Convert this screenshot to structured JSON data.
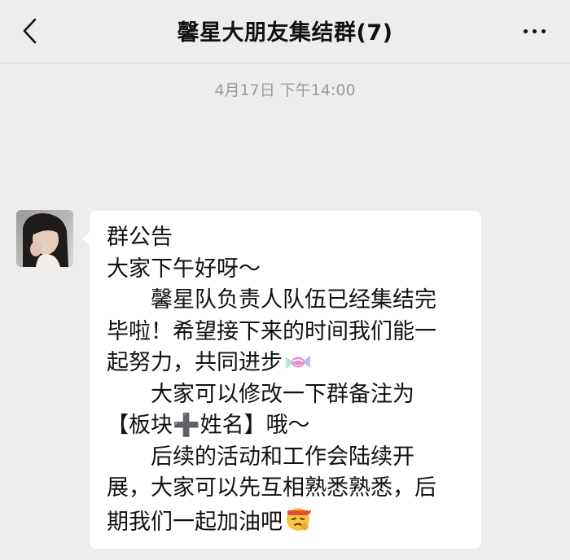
{
  "header": {
    "title": "馨星大朋友集结群(7)"
  },
  "timestamp": "4月17日 下午14:00",
  "message": {
    "lines": [
      "群公告",
      "大家下午好呀～",
      "馨星队负责人队伍已经集结完",
      "毕啦！希望接下来的时间我们能一",
      "起努力，共同进步",
      "大家可以修改一下群备注为",
      "【板块➕姓名】哦～",
      "后续的活动和工作会陆续开",
      "展，大家可以先互相熟悉熟悉，后",
      "期我们一起加油吧"
    ]
  },
  "icons": {
    "back": "chevron-left-icon",
    "more": "more-dots-icon",
    "candy": "candy-emoji-icon",
    "fighting": "fighting-face-emoji-icon"
  },
  "colors": {
    "background": "#ededed",
    "bubble": "#ffffff",
    "timestamp": "#9b9b9b"
  }
}
